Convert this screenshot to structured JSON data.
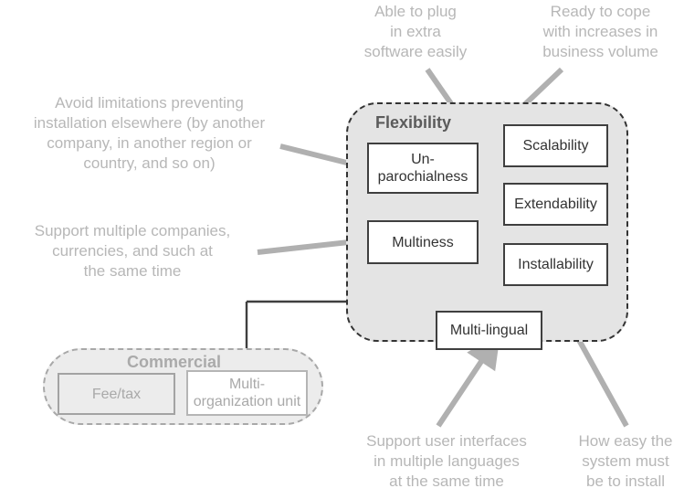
{
  "diagram": {
    "title": "Flexibility and Commercial quality attributes diagram",
    "colors": {
      "group_flexibility_fill": "#e4e4e4",
      "group_flexibility_border": "#333333",
      "group_commercial_fill": "#ececec",
      "group_commercial_border": "#a8a8a8",
      "node_border": "#3f3f3f",
      "node_fill": "#ffffff",
      "muted_text": "#a9a9a9",
      "annotation_text": "#b7b7b7",
      "callout_arrow": "#b0b0b0",
      "relation_line": "#3f3f3f"
    }
  },
  "groups": {
    "flexibility": {
      "label": "Flexibility"
    },
    "commercial": {
      "label": "Commercial"
    }
  },
  "nodes": {
    "unparochialness": {
      "label": "Un-\nparochialness"
    },
    "multiness": {
      "label": "Multiness"
    },
    "multilingual": {
      "label": "Multi-lingual"
    },
    "scalability": {
      "label": "Scalability"
    },
    "extendability": {
      "label": "Extendability"
    },
    "installability": {
      "label": "Installability"
    },
    "feetax": {
      "label": "Fee/tax"
    },
    "multiorganization_unit": {
      "label": "Multi-\norganization unit"
    }
  },
  "annotations": {
    "able_to_plug": "Able to plug\nin extra\nsoftware easily",
    "ready_to_cope": "Ready to cope\nwith increases in\nbusiness volume",
    "avoid_limitations": "Avoid limitations preventing\ninstallation elsewhere (by another\ncompany, in another region or\ncountry, and so on)",
    "support_multiple_companies": "Support multiple companies,\ncurrencies, and such at\nthe same time",
    "support_user_interfaces": "Support user interfaces\nin multiple languages\nat the same time",
    "how_easy_install": "How easy the\nsystem must\nbe to install"
  },
  "relations": [
    {
      "from": "multiness",
      "to": "unparochialness",
      "type": "solid-arrow"
    },
    {
      "from": "multilingual",
      "to": "multiness",
      "type": "generalization"
    },
    {
      "from": "multiorganization_unit",
      "to": "multiness",
      "type": "generalization"
    }
  ],
  "callouts": [
    {
      "annotation": "able_to_plug",
      "target": "extendability"
    },
    {
      "annotation": "ready_to_cope",
      "target": "scalability"
    },
    {
      "annotation": "avoid_limitations",
      "target": "unparochialness"
    },
    {
      "annotation": "support_multiple_companies",
      "target": "multiness"
    },
    {
      "annotation": "support_user_interfaces",
      "target": "multilingual"
    },
    {
      "annotation": "how_easy_install",
      "target": "installability"
    }
  ]
}
